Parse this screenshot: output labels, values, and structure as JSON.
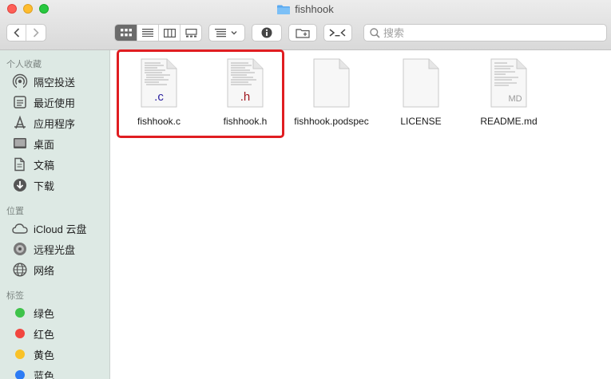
{
  "window": {
    "title": "fishhook"
  },
  "toolbar": {
    "search_placeholder": "搜索",
    "back_icon": "chevron-left-icon",
    "forward_icon": "chevron-right-icon"
  },
  "sidebar": {
    "favorites_title": "个人收藏",
    "favorites": [
      {
        "label": "隔空投送",
        "icon": "airdrop-icon"
      },
      {
        "label": "最近使用",
        "icon": "recents-icon"
      },
      {
        "label": "应用程序",
        "icon": "applications-icon"
      },
      {
        "label": "桌面",
        "icon": "desktop-icon"
      },
      {
        "label": "文稿",
        "icon": "documents-icon"
      },
      {
        "label": "下载",
        "icon": "downloads-icon"
      }
    ],
    "locations_title": "位置",
    "locations": [
      {
        "label": "iCloud 云盘",
        "icon": "icloud-icon"
      },
      {
        "label": "远程光盘",
        "icon": "remote-disc-icon"
      },
      {
        "label": "网络",
        "icon": "network-icon"
      }
    ],
    "tags_title": "标签",
    "tags": [
      {
        "label": "绿色",
        "color": "#3ec34a"
      },
      {
        "label": "红色",
        "color": "#f2463f"
      },
      {
        "label": "黄色",
        "color": "#f9c228"
      },
      {
        "label": "蓝色",
        "color": "#2d7bf4"
      }
    ]
  },
  "files": [
    {
      "name": "fishhook.c",
      "ext": ".c",
      "ext_color": "#2a1f9e",
      "selected": true
    },
    {
      "name": "fishhook.h",
      "ext": ".h",
      "ext_color": "#a0171f",
      "selected": true
    },
    {
      "name": "fishhook.podspec",
      "ext": "",
      "selected": false
    },
    {
      "name": "LICENSE",
      "ext": "",
      "selected": false
    },
    {
      "name": "README.md",
      "ext": "MD",
      "ext_color": "#9a9a9a",
      "selected": false
    }
  ],
  "colors": {
    "selection": "#e01d21",
    "sidebar_bg": "#dde9e4",
    "folder": "#5aa9f0"
  }
}
